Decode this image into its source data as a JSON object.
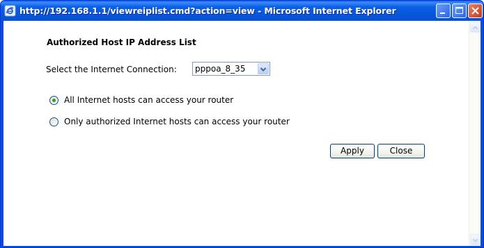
{
  "window": {
    "title": "http://192.168.1.1/viewreiplist.cmd?action=view - Microsoft Internet Explorer"
  },
  "page": {
    "heading": "Authorized Host IP Address List",
    "connection_label": "Select the Internet Connection:",
    "connection_select": {
      "selected": "pppoa_8_35"
    },
    "access_options": [
      {
        "label": "All Internet hosts can access your router",
        "selected": true
      },
      {
        "label": "Only authorized Internet hosts can access your router",
        "selected": false
      }
    ],
    "buttons": {
      "apply": "Apply",
      "close": "Close"
    }
  },
  "colors": {
    "titlebar": "#0b60e6",
    "close_button": "#c43a19",
    "radio_dot": "#2ba22b"
  }
}
